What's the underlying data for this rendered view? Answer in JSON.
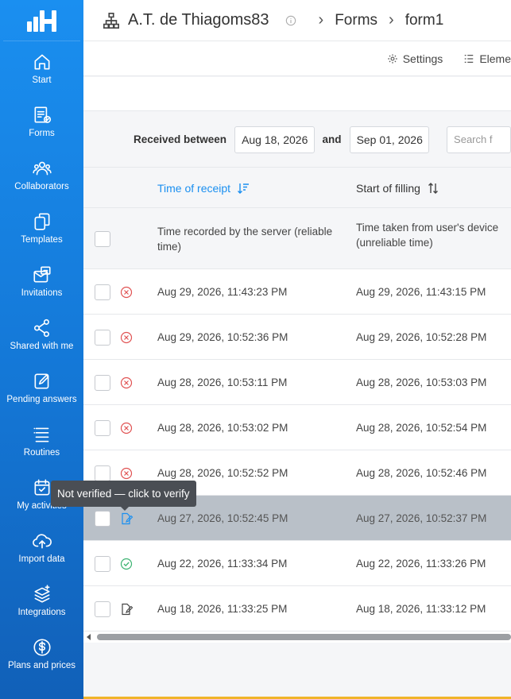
{
  "app": {
    "org_name": "A.T. de Thiagoms83",
    "breadcrumbs": [
      "Forms",
      "form1"
    ]
  },
  "sidebar": {
    "items": [
      {
        "label": "Start",
        "icon": "home-icon"
      },
      {
        "label": "Forms",
        "icon": "forms-icon"
      },
      {
        "label": "Collaborators",
        "icon": "collaborators-icon"
      },
      {
        "label": "Templates",
        "icon": "templates-icon"
      },
      {
        "label": "Invitations",
        "icon": "invitations-icon"
      },
      {
        "label": "Shared with me",
        "icon": "share-icon"
      },
      {
        "label": "Pending answers",
        "icon": "edit-icon"
      },
      {
        "label": "Routines",
        "icon": "routines-icon"
      },
      {
        "label": "My activities",
        "icon": "calendar-check-icon"
      },
      {
        "label": "Import data",
        "icon": "cloud-upload-icon"
      },
      {
        "label": "Integrations",
        "icon": "layers-icon"
      },
      {
        "label": "Plans and prices",
        "icon": "dollar-icon"
      }
    ]
  },
  "toolbar": {
    "settings_label": "Settings",
    "elements_label": "Eleme"
  },
  "filter": {
    "received_between_label": "Received between",
    "start_date": "Aug 18, 2026",
    "and_label": "and",
    "end_date": "Sep 01, 2026",
    "search_placeholder": "Search f"
  },
  "table": {
    "columns": [
      {
        "label": "Time of receipt",
        "description": "Time recorded by the server (reliable time)",
        "sort": "desc"
      },
      {
        "label": "Start of filling",
        "description_line1": "Time taken from user's device",
        "description_line2": "(unreliable time)",
        "sort": "none"
      }
    ],
    "rows": [
      {
        "status": "error",
        "receipt": "Aug 29, 2026, 11:43:23 PM",
        "start": "Aug 29, 2026, 11:43:15 PM"
      },
      {
        "status": "error",
        "receipt": "Aug 29, 2026, 10:52:36 PM",
        "start": "Aug 29, 2026, 10:52:28 PM"
      },
      {
        "status": "error",
        "receipt": "Aug 28, 2026, 10:53:11 PM",
        "start": "Aug 28, 2026, 10:53:03 PM"
      },
      {
        "status": "error",
        "receipt": "Aug 28, 2026, 10:53:02 PM",
        "start": "Aug 28, 2026, 10:52:54 PM"
      },
      {
        "status": "error",
        "receipt": "Aug 28, 2026, 10:52:52 PM",
        "start": "Aug 28, 2026, 10:52:46 PM"
      },
      {
        "status": "unverified",
        "receipt": "Aug 27, 2026, 10:52:45 PM",
        "start": "Aug 27, 2026, 10:52:37 PM",
        "selected": true
      },
      {
        "status": "verified",
        "receipt": "Aug 22, 2026, 11:33:34 PM",
        "start": "Aug 22, 2026, 11:33:26 PM"
      },
      {
        "status": "unverified",
        "receipt": "Aug 18, 2026, 11:33:25 PM",
        "start": "Aug 18, 2026, 11:33:12 PM"
      }
    ]
  },
  "tooltip": {
    "text": "Not verified — click to verify"
  },
  "colors": {
    "accent": "#1a8ff0",
    "error": "#e05252",
    "success": "#3cb371",
    "selected_row": "#b9c0c8"
  }
}
